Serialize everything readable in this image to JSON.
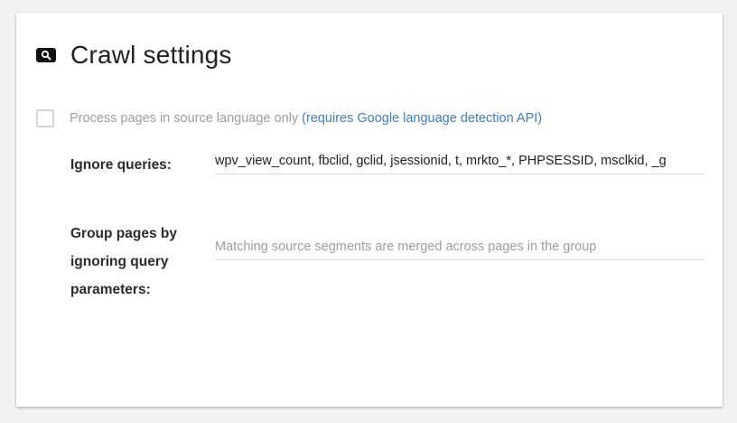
{
  "card": {
    "title": "Crawl settings",
    "icon": "search-icon"
  },
  "source_language": {
    "label": "Process pages in source language only",
    "link_text": "(requires Google language detection API)",
    "checked": false
  },
  "ignore_queries": {
    "label": "Ignore queries:",
    "value": "wpv_view_count, fbclid, gclid, jsessionid, t, mrkto_*, PHPSESSID, msclkid, _g"
  },
  "group_pages": {
    "label_line1": "Group pages by",
    "label_line2": "ignoring query",
    "label_line3": "parameters:",
    "value": "",
    "placeholder": "Matching source segments are merged across pages in the group"
  },
  "colors": {
    "link": "#3f7dbd",
    "muted_text": "#9e9e9e",
    "title_text": "#212121"
  }
}
